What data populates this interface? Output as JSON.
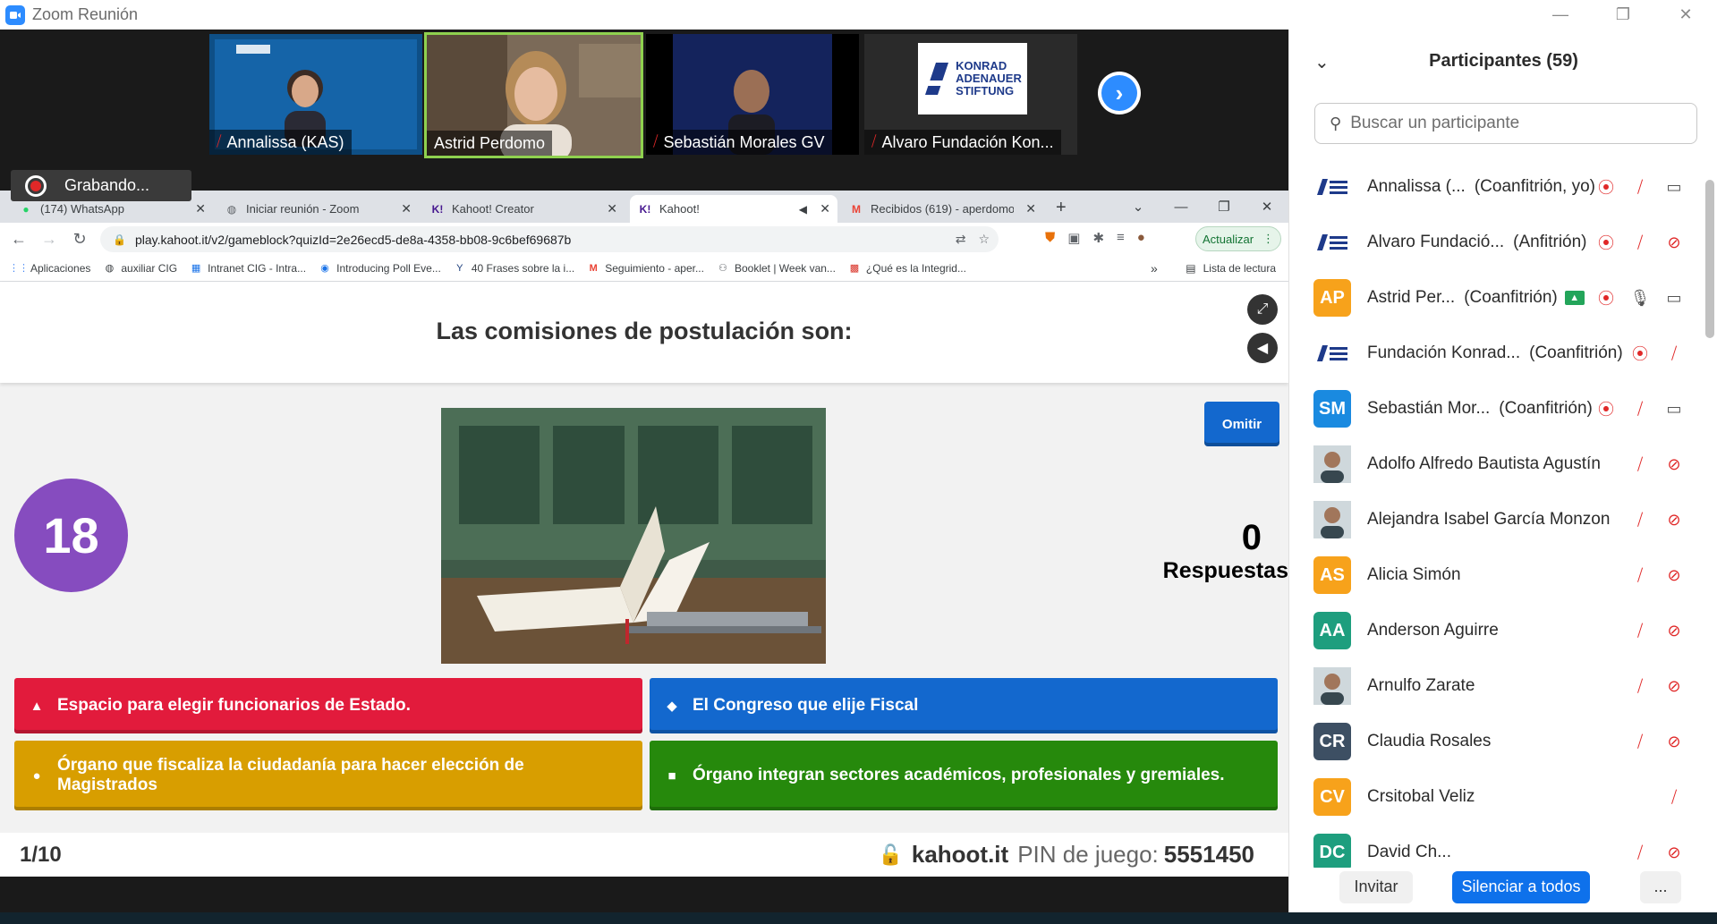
{
  "window": {
    "title": "Zoom Reunión"
  },
  "video_tiles": [
    {
      "name": "Annalissa (KAS)",
      "muted": true
    },
    {
      "name": "Astrid Perdomo",
      "muted": false
    },
    {
      "name": "Sebastián Morales GV",
      "muted": true
    },
    {
      "name": "Alvaro Fundación Kon...",
      "muted": true
    }
  ],
  "kas_logo": {
    "line1": "KONRAD",
    "line2": "ADENAUER",
    "line3": "STIFTUNG"
  },
  "recording": {
    "label": "Grabando..."
  },
  "browser": {
    "tabs": [
      {
        "label": "(174) WhatsApp",
        "icon": "whatsapp-icon"
      },
      {
        "label": "Iniciar reunión - Zoom",
        "icon": "globe-icon"
      },
      {
        "label": "Kahoot! Creator",
        "icon": "kahoot-icon"
      },
      {
        "label": "Kahoot!",
        "icon": "kahoot-icon"
      },
      {
        "label": "Recibidos (619) - aperdomo",
        "icon": "gmail-icon"
      }
    ],
    "url": "play.kahoot.it/v2/gameblock?quizId=2e26ecd5-de8a-4358-bb08-9c6bef69687b",
    "update_label": "Actualizar",
    "bookmarks": [
      "Aplicaciones",
      "auxiliar CIG",
      "Intranet CIG - Intra...",
      "Introducing Poll Eve...",
      "40 Frases sobre la i...",
      "Seguimiento - aper...",
      "Booklet | Week van...",
      "¿Qué es la Integrid..."
    ],
    "reading_list": "Lista de lectura"
  },
  "kahoot": {
    "question": "Las comisiones de postulación son:",
    "timer": "18",
    "skip_label": "Omitir",
    "answers_count": "0",
    "answers_label": "Respuestas",
    "answers": [
      {
        "text": "Espacio para elegir funcionarios de Estado.",
        "shape": "triangle",
        "color": "#e21b3c"
      },
      {
        "text": "El Congreso que elije Fiscal",
        "shape": "diamond",
        "color": "#1368ce"
      },
      {
        "text": "Órgano que fiscaliza la ciudadanía para hacer elección de Magistrados",
        "shape": "circle",
        "color": "#d89e00"
      },
      {
        "text": "Órgano integran sectores académicos, profesionales y gremiales.",
        "shape": "square",
        "color": "#26890c"
      }
    ],
    "progress": "1/10",
    "host": "kahoot.it",
    "pin_label": "PIN de juego:",
    "pin": "5551450"
  },
  "participants_panel": {
    "title": "Participantes (59)",
    "search_placeholder": "Buscar un participante",
    "participants": [
      {
        "name": "Annalissa (...",
        "role": "(Coanfitrión, yo)",
        "avatar": "logo",
        "icons": [
          "recording-icon",
          "mic-muted-icon",
          "video-on-icon"
        ]
      },
      {
        "name": "Alvaro Fundació...",
        "role": "(Anfitrión)",
        "avatar": "logo",
        "icons": [
          "recording-icon",
          "mic-muted-icon",
          "video-off-icon"
        ]
      },
      {
        "name": "Astrid Per...",
        "role": "(Coanfitrión)",
        "avatar": "AP",
        "avatar_color": "#f7a21b",
        "share": true,
        "icons": [
          "recording-icon",
          "mic-on-icon",
          "video-on-icon"
        ]
      },
      {
        "name": "Fundación Konrad...",
        "role": "(Coanfitrión)",
        "avatar": "logo",
        "icons": [
          "recording-icon",
          "mic-muted-icon"
        ]
      },
      {
        "name": "Sebastián Mor...",
        "role": "(Coanfitrión)",
        "avatar": "SM",
        "avatar_color": "#1a8ae0",
        "icons": [
          "recording-icon",
          "mic-muted-icon",
          "video-on-icon"
        ]
      },
      {
        "name": "Adolfo Alfredo Bautista Agustín",
        "role": "",
        "avatar": "photo",
        "icons": [
          "mic-muted-icon",
          "video-off-icon"
        ]
      },
      {
        "name": "Alejandra Isabel García Monzon",
        "role": "",
        "avatar": "photo",
        "icons": [
          "mic-muted-icon",
          "video-off-icon"
        ]
      },
      {
        "name": "Alicia Simón",
        "role": "",
        "avatar": "AS",
        "avatar_color": "#f7a21b",
        "icons": [
          "mic-muted-icon",
          "video-off-icon"
        ]
      },
      {
        "name": "Anderson Aguirre",
        "role": "",
        "avatar": "AA",
        "avatar_color": "#1e9e7e",
        "icons": [
          "mic-muted-icon",
          "video-off-icon"
        ]
      },
      {
        "name": "Arnulfo Zarate",
        "role": "",
        "avatar": "photo",
        "icons": [
          "mic-muted-icon",
          "video-off-icon"
        ]
      },
      {
        "name": "Claudia Rosales",
        "role": "",
        "avatar": "CR",
        "avatar_color": "#3d4f63",
        "icons": [
          "mic-muted-icon",
          "video-off-icon"
        ]
      },
      {
        "name": "Crsitobal Veliz",
        "role": "",
        "avatar": "CV",
        "avatar_color": "#f7a21b",
        "icons": [
          "mic-muted-icon"
        ]
      },
      {
        "name": "David Ch...",
        "role": "",
        "avatar": "DC",
        "avatar_color": "#1e9e7e",
        "icons": [
          "mic-muted-icon",
          "video-off-icon"
        ]
      }
    ],
    "invite_label": "Invitar",
    "mute_all_label": "Silenciar a todos",
    "more_label": "..."
  }
}
